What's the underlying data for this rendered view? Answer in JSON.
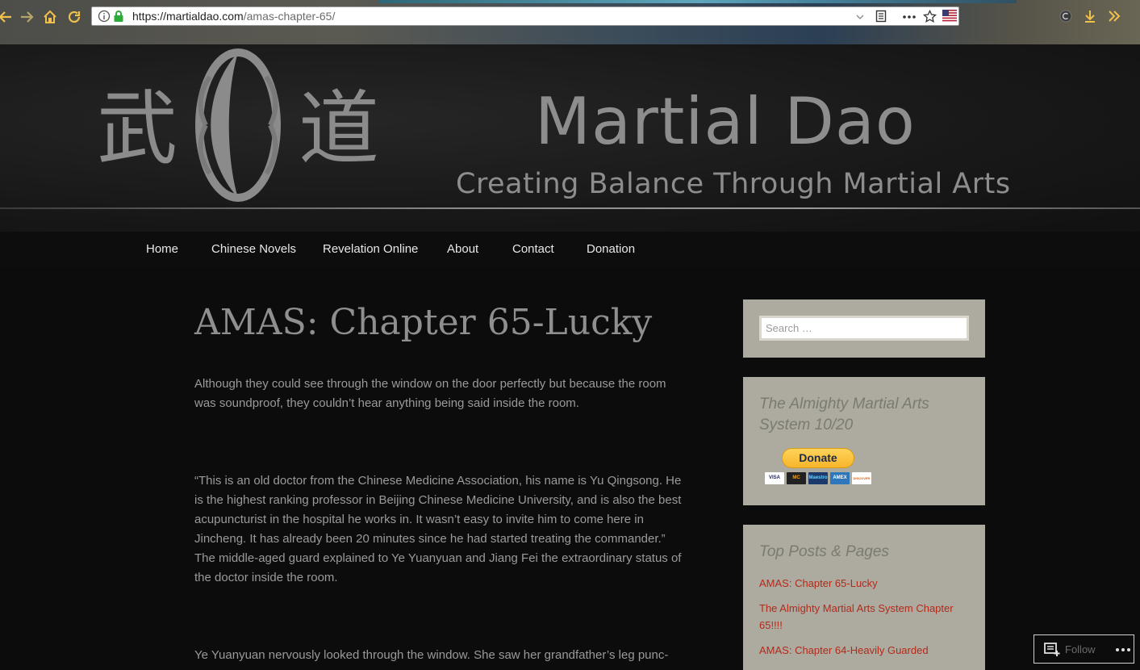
{
  "browser": {
    "url_host": "https://martialdao.com",
    "url_path": "/amas-chapter-65/"
  },
  "site": {
    "logo_char_1": "武",
    "logo_char_2": "道",
    "title": "Martial Dao",
    "tagline": "Creating Balance Through Martial Arts"
  },
  "nav": {
    "items": [
      "Home",
      "Chinese Novels",
      "Revelation Online",
      "About",
      "Contact",
      "Donation"
    ]
  },
  "article": {
    "title": "AMAS: Chapter 65-Lucky",
    "paragraphs": [
      "Although they could see through the window on the door perfectly but because the room was soundproof, they couldn’t hear anything being said inside the room.",
      "“This is an old doctor from the Chinese Medicine Association, his name is Yu Qingsong. He is the highest ranking professor in Beijing Chinese Medicine University, and is also the best acupuncturist in the hospital he works in. It wasn’t easy to invite him to come here in Jincheng. It has already been 20 minutes since he had started treating the commander.” The middle-aged guard explained to Ye Yuanyuan and Jiang Fei the extraordinary status of the doctor inside the room.",
      "Ye Yuanyuan nervously looked through the window. She saw her grandfather’s leg punc-"
    ]
  },
  "sidebar": {
    "search_placeholder": "Search …",
    "donate_widget_title": "The Almighty Martial Arts System 10/20",
    "donate_label": "Donate",
    "cards": [
      "VISA",
      "MC",
      "Maestro",
      "AMEX",
      "DISCOVER"
    ],
    "top_posts_title": "Top Posts & Pages",
    "top_posts": [
      "AMAS: Chapter 65-Lucky",
      "The Almighty Martial Arts System Chapter 65!!!!",
      "AMAS: Chapter 64-Heavily Guarded"
    ]
  },
  "follow": {
    "label": "Follow"
  },
  "colors": {
    "accent_link": "#b22a1a",
    "sidebar_bg": "#adaba0",
    "page_bg": "#0c0c0c"
  }
}
